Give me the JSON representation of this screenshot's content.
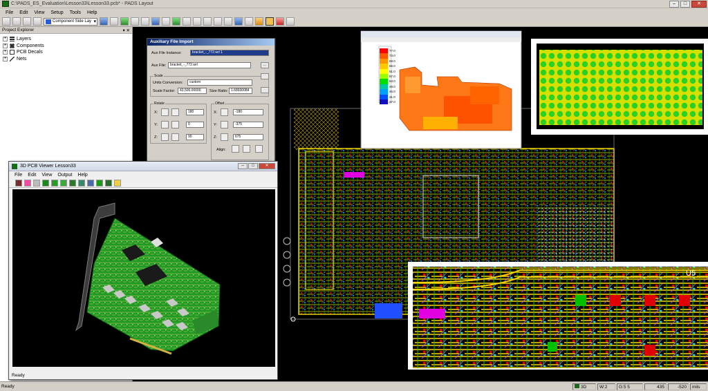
{
  "window": {
    "title": "C:\\PADS_ES_Evaluation\\Lesson33\\Lesson33.pcb* - PADS Layout"
  },
  "menubar": {
    "items": [
      "File",
      "Edit",
      "View",
      "Setup",
      "Tools",
      "Help"
    ]
  },
  "toolbar": {
    "layer_select": "Component Side Lay"
  },
  "explorer": {
    "title": "Project Explorer",
    "items": [
      {
        "label": "Layers"
      },
      {
        "label": "Components"
      },
      {
        "label": "PCB Decals"
      },
      {
        "label": "Nets"
      }
    ]
  },
  "aux_dialog": {
    "title": "Auxiliary File Import",
    "file_instance_label": "Aux File Instance:",
    "file_instance_value": "bracket_-_772.wrl 1",
    "aux_file_label": "Aux File:",
    "aux_file_value": "bracket_-_772.wrl",
    "browse_label": "...",
    "scale_group": "Scale",
    "units_label": "Units Conversion:",
    "units_value": "custom",
    "scale_factor_label": "Scale Factor:",
    "scale_factor_value": "43,500.00000",
    "size_ratio_label": "Size Ratio:",
    "size_ratio_value": "1.68930084",
    "rotate_group": "Rotate",
    "offset_group": "Offset",
    "axis_x": "X:",
    "axis_y": "Y:",
    "axis_z": "Z:",
    "rotate_x": "180",
    "rotate_y": "0",
    "rotate_z": "90",
    "offset_x": "-180",
    "offset_y": "-375",
    "offset_z": "675",
    "align_label": "Align:"
  },
  "viewer": {
    "title": "3D PCB Viewer  Lesson33",
    "menu": [
      "File",
      "Edit",
      "View",
      "Output",
      "Help"
    ],
    "status": "Ready"
  },
  "thermal": {
    "legend_values": [
      "77.0",
      "73.0",
      "69.0",
      "65.0",
      "61.0",
      "57.0",
      "53.0",
      "49.0",
      "45.0",
      "41.0",
      "37.0"
    ],
    "colors": [
      "#ff0000",
      "#ff5a00",
      "#ff9600",
      "#ffc800",
      "#ffff00",
      "#9cff00",
      "#00e000",
      "#00c8a0",
      "#00a0ff",
      "#0050ff",
      "#1010c0"
    ]
  },
  "statusbar": {
    "ready": "Ready",
    "view_mode": "3D",
    "width": "W:2",
    "grid": "G:5 5",
    "x": "435",
    "y": "-520",
    "units": "mils"
  },
  "colors": {
    "board_yellow": "#e8d000",
    "trace_green": "#00c000",
    "pad_red": "#e00000",
    "pad_cyan": "#00a0e0",
    "background": "#000000"
  }
}
